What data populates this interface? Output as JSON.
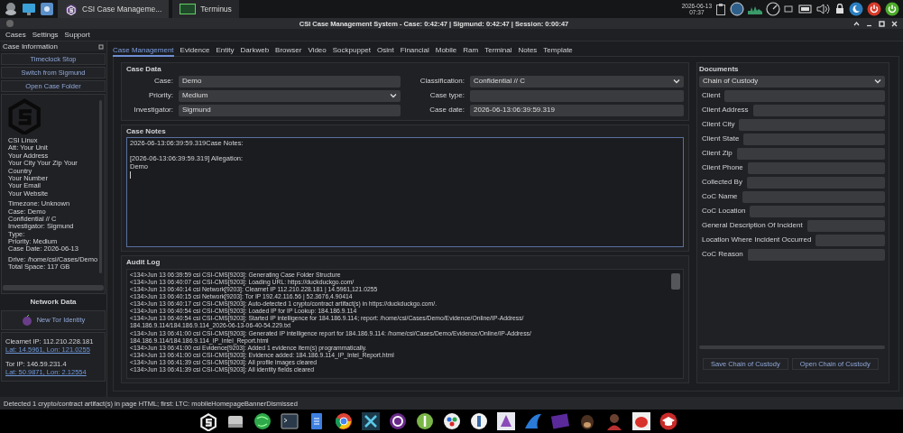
{
  "taskbar": {
    "tasks": [
      {
        "label": "CSI Case Manageme..."
      },
      {
        "label": "Terminus"
      }
    ],
    "date": "2026-06-13",
    "time": "07:37"
  },
  "window": {
    "title": "CSI Case Management System - Case: 0:42:47 | Sigmund: 0:42:47 | Session: 0:00:47"
  },
  "menu": [
    "Cases",
    "Settings",
    "Support"
  ],
  "sidebar": {
    "header": "Case Information",
    "buttons": [
      "Timeclock Stop",
      "Switch from Sigmund",
      "Open Case Folder"
    ],
    "info_groups": [
      [
        "CSI Linux",
        "Att: Your Unit",
        "Your Address",
        "Your City Your Zip Your Country",
        "Your Number",
        "Your Email",
        "Your Website"
      ],
      [
        "Timezone: Unknown",
        "Case: Demo",
        "Confidential // C",
        "Investigator: Sigmund",
        "Type:",
        "Priority: Medium",
        "Case Date: 2026-06-13"
      ],
      [
        "Drive: /home/csi/Cases/Demo",
        "Total Space: 117 GB"
      ]
    ],
    "network_header": "Network Data",
    "tor_button": "New Tor Identity",
    "ips": [
      {
        "ip": "Clearnet IP: 112.210.228.181",
        "location": "Lat: 14.5961, Lon: 121.0255"
      },
      {
        "ip": "Tor IP: 146.59.231.4",
        "location": "Lat: 50.9871, Lon: 2.12554"
      }
    ]
  },
  "tabs": [
    {
      "label": "Case Management",
      "selected": true
    },
    {
      "label": "Evidence",
      "selected": false
    },
    {
      "label": "Entity",
      "selected": false
    },
    {
      "label": "Darkweb",
      "selected": false
    },
    {
      "label": "Browser",
      "selected": false
    },
    {
      "label": "Video",
      "selected": false
    },
    {
      "label": "Sockpuppet",
      "selected": false
    },
    {
      "label": "Osint",
      "selected": false
    },
    {
      "label": "Financial",
      "selected": false
    },
    {
      "label": "Mobile",
      "selected": false
    },
    {
      "label": "Ram",
      "selected": false
    },
    {
      "label": "Terminal",
      "selected": false
    },
    {
      "label": "Notes",
      "selected": false
    },
    {
      "label": "Template",
      "selected": false
    }
  ],
  "case_data": {
    "title": "Case Data",
    "fields": [
      {
        "label": "Case:",
        "value": "Demo",
        "kind": "text"
      },
      {
        "label": "Classification:",
        "value": "Confidential // C",
        "kind": "select"
      },
      {
        "label": "Priority:",
        "value": "Medium",
        "kind": "select"
      },
      {
        "label": "Case type:",
        "kind": "text"
      },
      {
        "label": "Investigator:",
        "value": "Sigmund",
        "kind": "text"
      },
      {
        "label": "Case date:",
        "value": "2026-06-13:06:39:59.319",
        "kind": "text"
      }
    ]
  },
  "case_notes": {
    "title": "Case Notes",
    "text": "2026-06-13:06:39:59.319Case Notes:\n\n[2026-06-13:06:39:59.319] Allegation:\nDemo"
  },
  "audit_log": {
    "title": "Audit Log",
    "lines": [
      "<134>Jun 13 06:39:59 csi CSI-CMS[9203]: Generating Case Folder Structure",
      "<134>Jun 13 06:40:07 csi CSI-CMS[9203]: Loading URL: https://duckduckgo.com/",
      "<134>Jun 13 06:40:14 csi Network[9203]: Clearnet IP 112.210.228.181 | 14.5961,121.0255",
      "<134>Jun 13 06:40:15 csi Network[9203]: Tor IP 192.42.116.56 | 52.3676,4.90414",
      "<134>Jun 13 06:40:17 csi CSI-CMS[9203]: Auto-detected 1 crypto/contract artifact(s) in https://duckduckgo.com/.",
      "<134>Jun 13 06:40:54 csi CSI-CMS[9203]: Loaded IP for IP Lookup: 184.186.9.114",
      "<134>Jun 13 06:40:54 csi CSI-CMS[9203]: Started IP intelligence for 184.186.9.114; report: /home/csi/Cases/Demo/Evidence/Online/IP-Address/\n184.186.9.114/184.186.9.114_2026-06-13-06-40-54.229.txt",
      "<134>Jun 13 06:41:00 csi CSI-CMS[9203]: Generated IP intelligence report for 184.186.9.114: /home/csi/Cases/Demo/Evidence/Online/IP-Address/\n184.186.9.114/184.186.9.114_IP_Intel_Report.html",
      "<134>Jun 13 06:41:00 csi Evidence[9203]: Added 1 evidence item(s) programmatically.",
      "<134>Jun 13 06:41:00 csi CSI-CMS[9203]: Evidence added: 184.186.9.114_IP_Intel_Report.html",
      "<134>Jun 13 06:41:39 csi CSI-CMS[9203]: All profile images cleared",
      "<134>Jun 13 06:41:39 csi CSI-CMS[9203]: All identity fields cleared"
    ]
  },
  "documents": {
    "title": "Documents",
    "template": "Chain of Custody",
    "fields": [
      "Client",
      "Client Address",
      "Client City",
      "Client State",
      "Client Zip",
      "Client Phone",
      "Collected By",
      "CoC Name",
      "CoC Location",
      "General Description Of Incident",
      "Location Where Incident Occurred",
      "CoC Reason"
    ],
    "buttons": [
      "Save Chain of Custody",
      "Open Chain of Custody"
    ]
  },
  "status_bar": "Detected 1 crypto/contract artifact(s) in page HTML; first: LTC: mobileHomepageBannerDismissed"
}
